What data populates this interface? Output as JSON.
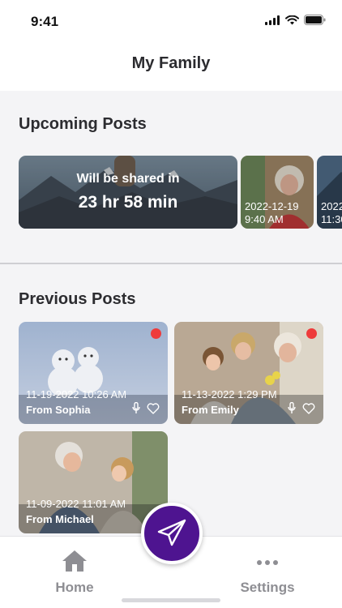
{
  "status_bar": {
    "time": "9:41"
  },
  "header": {
    "title": "My Family"
  },
  "upcoming": {
    "title": "Upcoming Posts",
    "countdown_label": "Will be shared in",
    "countdown_value": "23 hr 58 min",
    "scheduled": [
      {
        "date": "2022-12-19",
        "time": "9:40 AM"
      },
      {
        "date": "2022",
        "time": "11:30"
      }
    ]
  },
  "previous": {
    "title": "Previous Posts",
    "posts": [
      {
        "date": "11-19-2022 10:26 AM",
        "from": "From Sophia",
        "unread": true,
        "has_audio": true
      },
      {
        "date": "11-13-2022 1:29 PM",
        "from": "From Emily",
        "unread": true,
        "has_audio": true
      },
      {
        "date": "11-09-2022 11:01 AM",
        "from": "From Michael",
        "unread": false,
        "has_audio": false
      }
    ]
  },
  "tabs": [
    {
      "label": "Home",
      "icon": "home-icon"
    },
    {
      "label": "Settings",
      "icon": "more-icon"
    }
  ],
  "fab": {
    "icon": "paper-plane-icon"
  },
  "colors": {
    "accent": "#4e1490",
    "unread_dot": "#ee3b3b",
    "tab_inactive": "#8e8e93"
  }
}
